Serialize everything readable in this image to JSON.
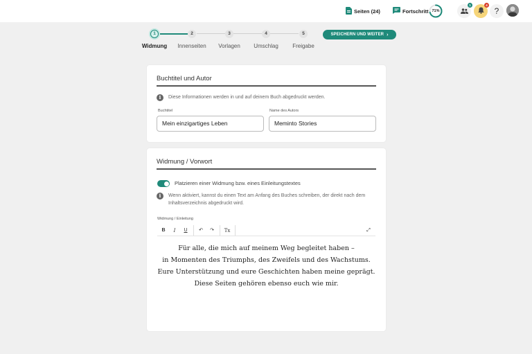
{
  "topbar": {
    "pages_label": "Seiten (24)",
    "progress_label": "Fortschritt",
    "progress_percent": "71%",
    "progress_value": 0.71,
    "collab_badge": "1",
    "notif_badge": "4",
    "help_label": "?"
  },
  "stepper": {
    "steps": [
      {
        "num": "1",
        "label": "Widmung"
      },
      {
        "num": "2",
        "label": "Innenseiten"
      },
      {
        "num": "3",
        "label": "Vorlagen"
      },
      {
        "num": "4",
        "label": "Umschlag"
      },
      {
        "num": "5",
        "label": "Freigabe"
      }
    ],
    "active_index": 0,
    "save_button": "SPEICHERN UND WEITER"
  },
  "title_card": {
    "title": "Buchtitel und Autor",
    "info": "Diese Informationen werden in und auf deinem Buch abgedruckt werden.",
    "book_title_label": "Buchtitel",
    "book_title_value": "Mein einzigartiges Leben",
    "author_label": "Name des Autors",
    "author_value": "Meminto Stories"
  },
  "dedication_card": {
    "title": "Widmung / Vorwort",
    "toggle_label": "Platzieren einer Widmung bzw. eines Einleitungstextes",
    "toggle_on": true,
    "info_line1": "Wenn aktiviert, kannst du einen Text am Anfang des Buches schreiben, der direkt nach dem",
    "info_line2": "Inhaltsverzeichnis abgedruckt wird.",
    "editor_label": "Widmung / Einleitung",
    "toolbar": {
      "bold": "B",
      "italic": "I",
      "underline": "U",
      "undo": "↶",
      "redo": "↷",
      "clear_format": "Tx",
      "fullscreen": "⤢"
    },
    "text_lines": [
      "Für alle, die mich auf meinem Weg begleitet haben –",
      "in Momenten des Triumphs, des Zweifels und des Wachstums.",
      "Eure Unterstützung und eure Geschichten haben meine geprägt.",
      "Diese Seiten gehören ebenso euch wie mir."
    ]
  },
  "colors": {
    "accent": "#1f8a7a",
    "bell_bg": "#f6d57a",
    "badge_red": "#d8402c"
  }
}
